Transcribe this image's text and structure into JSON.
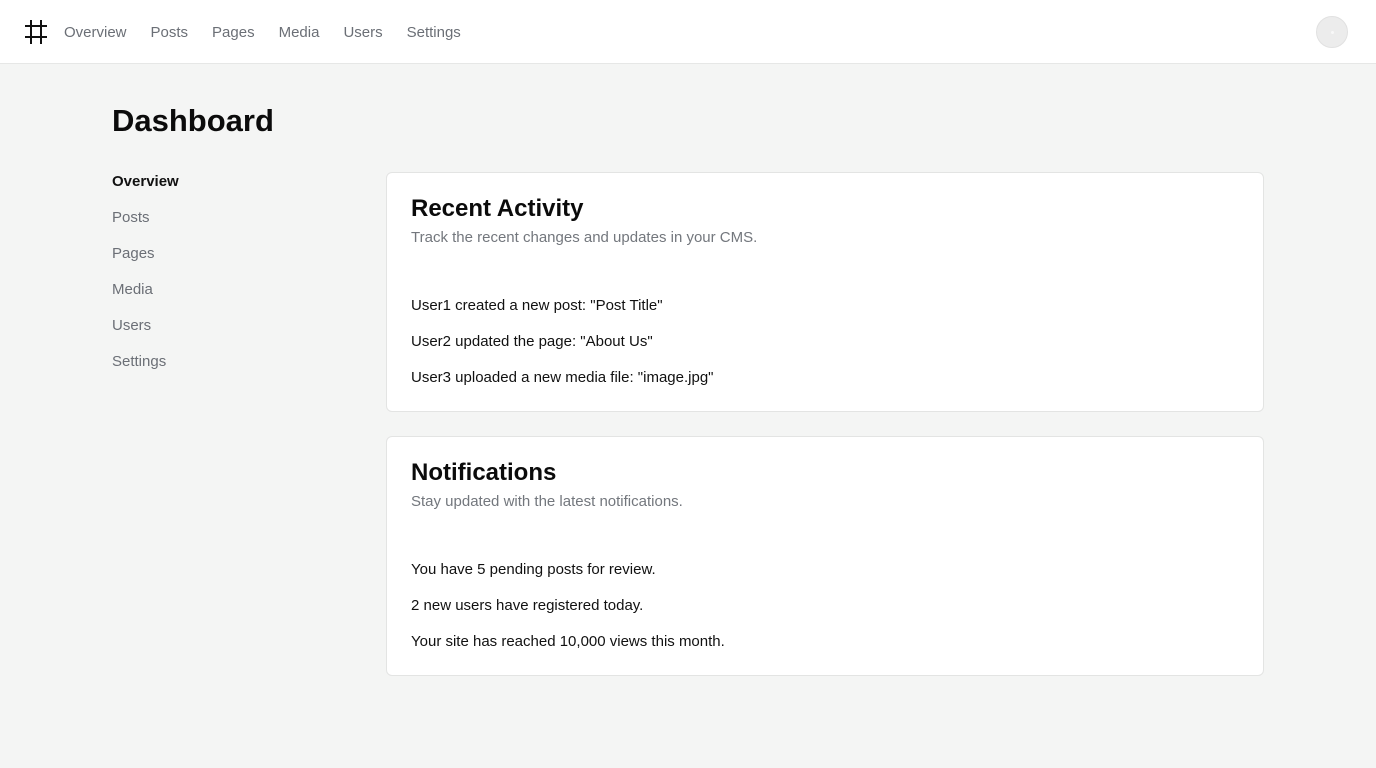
{
  "header": {
    "logo_icon": "hash-frame-icon",
    "nav": [
      "Overview",
      "Posts",
      "Pages",
      "Media",
      "Users",
      "Settings"
    ],
    "avatar_icon": "avatar"
  },
  "page": {
    "title": "Dashboard"
  },
  "sidebar": {
    "items": [
      {
        "label": "Overview",
        "active": true
      },
      {
        "label": "Posts",
        "active": false
      },
      {
        "label": "Pages",
        "active": false
      },
      {
        "label": "Media",
        "active": false
      },
      {
        "label": "Users",
        "active": false
      },
      {
        "label": "Settings",
        "active": false
      }
    ]
  },
  "cards": {
    "activity": {
      "title": "Recent Activity",
      "subtitle": "Track the recent changes and updates in your CMS.",
      "items": [
        "User1 created a new post: \"Post Title\"",
        "User2 updated the page: \"About Us\"",
        "User3 uploaded a new media file: \"image.jpg\""
      ]
    },
    "notifications": {
      "title": "Notifications",
      "subtitle": "Stay updated with the latest notifications.",
      "items": [
        "You have 5 pending posts for review.",
        "2 new users have registered today.",
        "Your site has reached 10,000 views this month."
      ]
    }
  },
  "colors": {
    "background": "#f4f5f4",
    "surface": "#ffffff",
    "muted_text": "#6b6f76",
    "text": "#111111"
  }
}
